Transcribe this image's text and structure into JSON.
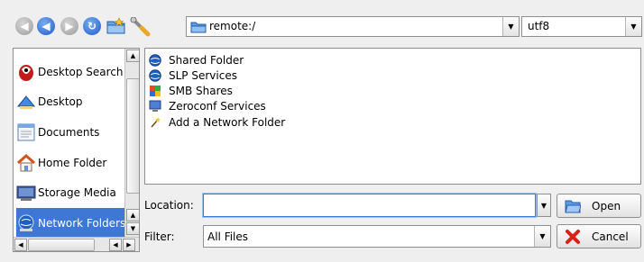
{
  "toolbar": {
    "buttons": [
      {
        "name": "back-button",
        "icon": "back-arrow-icon",
        "state": "disabled"
      },
      {
        "name": "up-button",
        "icon": "up-arrow-icon",
        "state": "enabled"
      },
      {
        "name": "forward-button",
        "icon": "forward-arrow-icon",
        "state": "disabled"
      },
      {
        "name": "reload-button",
        "icon": "reload-icon",
        "state": "enabled"
      },
      {
        "name": "new-folder-button",
        "icon": "new-folder-icon",
        "state": "enabled"
      },
      {
        "name": "options-button",
        "icon": "wrench-icon",
        "state": "enabled"
      }
    ],
    "path": "remote:/",
    "encoding": "utf8"
  },
  "places": {
    "items": [
      {
        "label": "Desktop Search",
        "icon": "desktop-search-icon"
      },
      {
        "label": "Desktop",
        "icon": "desktop-icon"
      },
      {
        "label": "Documents",
        "icon": "documents-icon"
      },
      {
        "label": "Home Folder",
        "icon": "home-folder-icon"
      },
      {
        "label": "Storage Media",
        "icon": "storage-media-icon"
      },
      {
        "label": "Network Folders",
        "icon": "network-folder-icon",
        "selected": true
      }
    ]
  },
  "files": [
    {
      "name": "Shared Folder",
      "icon": "globe-icon"
    },
    {
      "name": "SLP Services",
      "icon": "globe-icon"
    },
    {
      "name": "SMB Shares",
      "icon": "smb-shares-icon"
    },
    {
      "name": "Zeroconf Services",
      "icon": "monitor-icon"
    },
    {
      "name": "Add a Network Folder",
      "icon": "wizard-wand-icon"
    }
  ],
  "form": {
    "location_label": "Location:",
    "location_value": "",
    "filter_label": "Filter:",
    "filter_value": "All Files"
  },
  "buttons": {
    "open_label": "Open",
    "cancel_label": "Cancel"
  },
  "colors": {
    "selection": "#3e77d4",
    "focus_border": "#3e7bd4",
    "window_bg": "#efefef"
  }
}
